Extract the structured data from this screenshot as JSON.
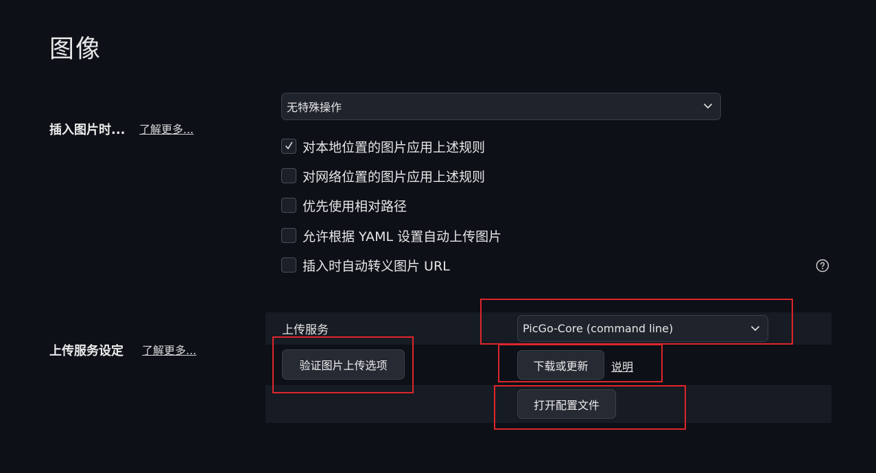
{
  "page": {
    "title": "图像"
  },
  "insert_image": {
    "label": "插入图片时...",
    "learn_more": "了解更多...",
    "select_value": "无特殊操作",
    "options": [
      {
        "label": "对本地位置的图片应用上述规则",
        "checked": true
      },
      {
        "label": "对网络位置的图片应用上述规则",
        "checked": false
      },
      {
        "label": "优先使用相对路径",
        "checked": false
      },
      {
        "label": "允许根据 YAML 设置自动上传图片",
        "checked": false
      },
      {
        "label": "插入时自动转义图片 URL",
        "checked": false
      }
    ],
    "help_icon": "question-circle-icon"
  },
  "upload_service": {
    "label": "上传服务设定",
    "learn_more": "了解更多...",
    "service_label": "上传服务",
    "service_value": "PicGo-Core (command line)",
    "verify_button": "验证图片上传选项",
    "download_button": "下载或更新",
    "instructions_link": "说明",
    "open_config_button": "打开配置文件"
  },
  "colors": {
    "background": "#0d1017",
    "annotation_red": "#e0262b"
  }
}
